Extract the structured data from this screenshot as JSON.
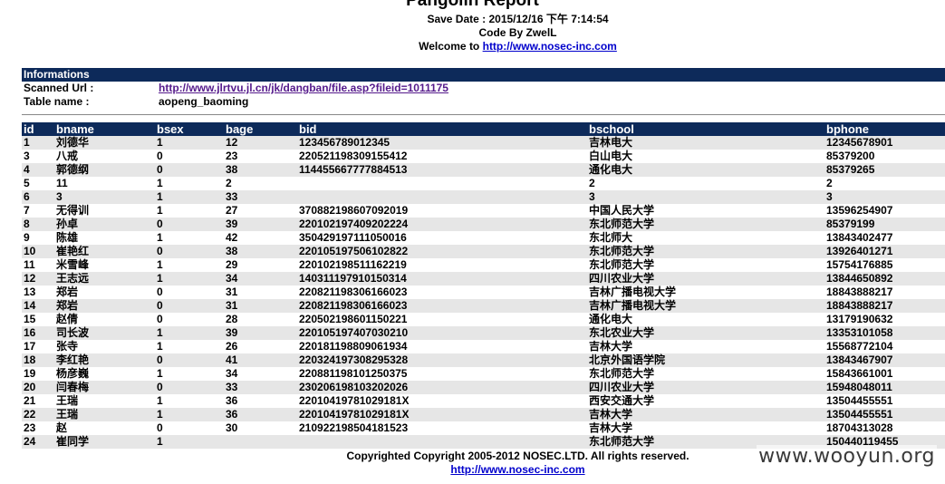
{
  "header": {
    "title": "Pangolin Report",
    "save_date": "Save Date : 2015/12/16 下午 7:14:54",
    "code_by": "Code By ZwelL",
    "welcome_prefix": "Welcome to ",
    "welcome_link": "http://www.nosec-inc.com"
  },
  "informations": {
    "title": "Informations",
    "scanned_url_label": "Scanned Url :",
    "scanned_url_value": "http://www.jlrtvu.jl.cn/jk/dangban/file.asp?fileid=1011175",
    "table_name_label": "Table name :",
    "table_name_value": "aopeng_baoming"
  },
  "table": {
    "columns": [
      "id",
      "bname",
      "bsex",
      "bage",
      "bid",
      "bschool",
      "bphone"
    ],
    "rows": [
      [
        "1",
        "刘德华",
        "1",
        "12",
        "123456789012345",
        "吉林电大",
        "12345678901"
      ],
      [
        "3",
        "八戒",
        "0",
        "23",
        "220521198309155412",
        "白山电大",
        "85379200"
      ],
      [
        "4",
        "郭德纲",
        "0",
        "38",
        "114455667777884513",
        "通化电大",
        "85379265"
      ],
      [
        "5",
        "11",
        "1",
        "2",
        "",
        "2",
        "2"
      ],
      [
        "6",
        "3",
        "1",
        "33",
        "",
        "3",
        "3"
      ],
      [
        "7",
        "无得训",
        "1",
        "27",
        "370882198607092019",
        "中国人民大学",
        "13596254907"
      ],
      [
        "8",
        "孙卓",
        "0",
        "39",
        "220102197409202224",
        "东北师范大学",
        "85379199"
      ],
      [
        "9",
        "陈雄",
        "1",
        "42",
        "350429197111050016",
        "东北师大",
        "13843402477"
      ],
      [
        "10",
        "崔艳红",
        "0",
        "38",
        "220105197506102822",
        "东北师范大学",
        "13926401271"
      ],
      [
        "11",
        "米雪峰",
        "1",
        "29",
        "220102198511162219",
        "东北师范大学",
        "15754176885"
      ],
      [
        "12",
        "王志远",
        "1",
        "34",
        "140311197910150314",
        "四川农业大学",
        "13844650892"
      ],
      [
        "13",
        "郑岩",
        "0",
        "31",
        "220821198306166023",
        "吉林广播电视大学",
        "18843888217"
      ],
      [
        "14",
        "郑岩",
        "0",
        "31",
        "220821198306166023",
        "吉林广播电视大学",
        "18843888217"
      ],
      [
        "15",
        "赵倩",
        "0",
        "28",
        "220502198601150221",
        "通化电大",
        "13179190632"
      ],
      [
        "16",
        "司长波",
        "1",
        "39",
        "220105197407030210",
        "东北农业大学",
        "13353101058"
      ],
      [
        "17",
        "张寺",
        "1",
        "26",
        "220181198809061934",
        "吉林大学",
        "15568772104"
      ],
      [
        "18",
        "李红艳",
        "0",
        "41",
        "220324197308295328",
        "北京外国语学院",
        "13843467907"
      ],
      [
        "19",
        "杨彦巍",
        "1",
        "34",
        "220881198101250375",
        "东北师范大学",
        "15843661001"
      ],
      [
        "20",
        "闫春梅",
        "0",
        "33",
        "230206198103202026",
        "四川农业大学",
        "15948048011"
      ],
      [
        "21",
        "王瑞",
        "1",
        "36",
        "22010419781029181X",
        "西安交通大学",
        "13504455551"
      ],
      [
        "22",
        "王瑞",
        "1",
        "36",
        "22010419781029181X",
        "吉林大学",
        "13504455551"
      ],
      [
        "23",
        "赵",
        "0",
        "30",
        "210922198504181523",
        "吉林大学",
        "18704313028"
      ],
      [
        "24",
        "崔同学",
        "1",
        "",
        "",
        "东北师范大学",
        "150440119455"
      ]
    ]
  },
  "footer": {
    "copyright": "Copyrighted Copyright 2005-2012 NOSEC.LTD. All rights reserved.",
    "link": "http://www.nosec-inc.com"
  },
  "watermark": "www.wooyun.org",
  "colors": {
    "header_bar": "#0d2a5a",
    "odd_row": "#e6e6e6",
    "link": "#0000cc",
    "visited_link": "#551a8b"
  }
}
